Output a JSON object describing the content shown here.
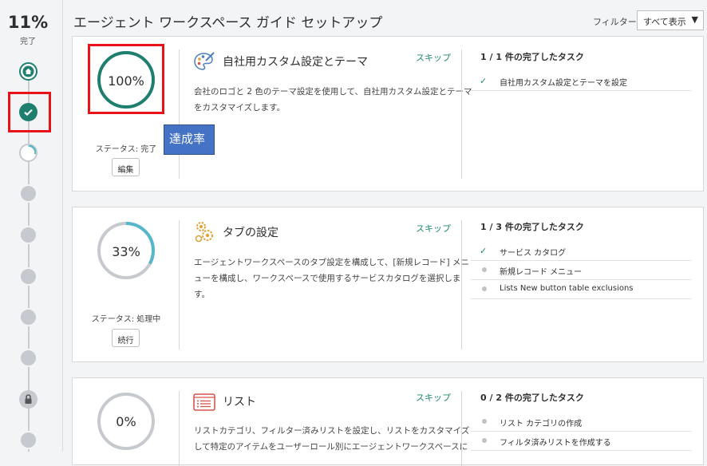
{
  "progress": {
    "percent_label": "11%",
    "label": "完了",
    "value": 0.11
  },
  "header": {
    "title": "エージェント ワークスペース ガイド セットアップ",
    "filter_label": "フィルター",
    "filter_value": "すべて表示"
  },
  "callout": {
    "text": "達成率"
  },
  "cards": [
    {
      "percent_label": "100%",
      "percent": 1.0,
      "status": "ステータス: 完了",
      "action": "編集",
      "title": "自社用カスタム設定とテーマ",
      "skip": "スキップ",
      "desc_lines": [
        "会社のロゴと 2 色のテーマ設定を使用して、自社用カスタム設定とテーマ",
        "をカスタマイズします。"
      ],
      "tasks_head": "1 / 1 件の完了したタスク",
      "tasks": [
        {
          "label": "自社用カスタム設定とテーマを設定",
          "done": true
        }
      ],
      "icon": "palette-icon"
    },
    {
      "percent_label": "33%",
      "percent": 0.33,
      "status": "ステータス: 処理中",
      "action": "続行",
      "title": "タブの設定",
      "skip": "スキップ",
      "desc_lines": [
        "エージェントワークスペースのタブ設定を構成して、[新規レコード] メニ",
        "ューを構成し、ワークスペースで使用するサービスカタログを選択しま",
        "す。"
      ],
      "tasks_head": "1 / 3 件の完了したタスク",
      "tasks": [
        {
          "label": "サービス カタログ",
          "done": true
        },
        {
          "label": "新規レコード メニュー",
          "done": false
        },
        {
          "label": "Lists New button table exclusions",
          "done": false
        }
      ],
      "icon": "gears-icon"
    },
    {
      "percent_label": "0%",
      "percent": 0.0,
      "title": "リスト",
      "skip": "スキップ",
      "desc_lines": [
        "リストカテゴリ、フィルター済みリストを設定し、リストをカスタマイズ",
        "して特定のアイテムをユーザーロール別にエージェントワークスペースに"
      ],
      "tasks_head": "0 / 2 件の完了したタスク",
      "tasks": [
        {
          "label": "リスト カテゴリの作成",
          "done": false
        },
        {
          "label": "フィルタ済みリストを作成する",
          "done": false
        }
      ],
      "icon": "list-icon"
    }
  ],
  "colors": {
    "accent": "#1f7f6f",
    "progress": "#55b6cc",
    "track": "#c6c9cd",
    "highlight": "#e8121a",
    "callout": "#4472c4"
  }
}
